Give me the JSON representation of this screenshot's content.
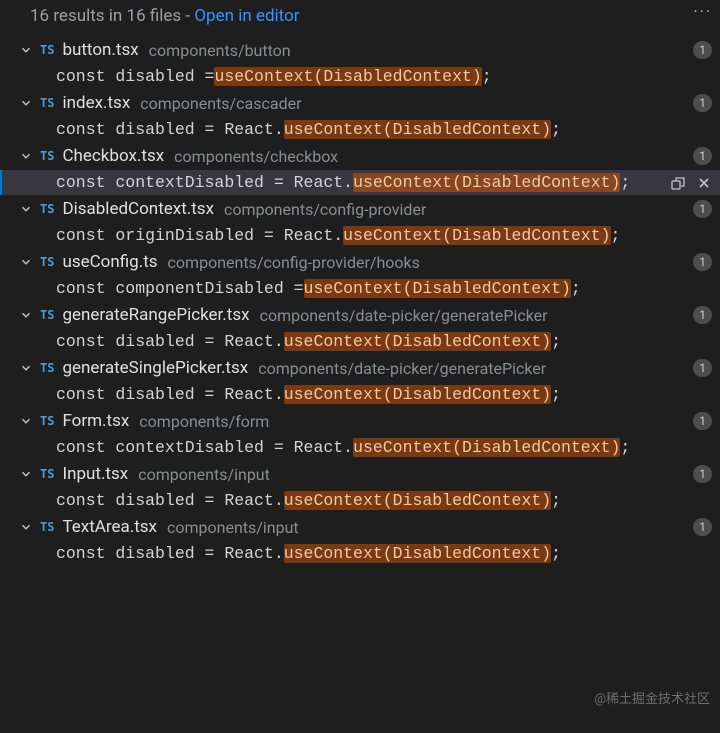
{
  "summary": {
    "text_left": "16 results in 16 files - ",
    "link": "Open in editor"
  },
  "ts_label": "TS",
  "more_label": "···",
  "watermark": "@稀土掘金技术社区",
  "files": [
    {
      "name": "button.tsx",
      "path": "components/button",
      "count": "1",
      "match": {
        "pre": "const disabled = ",
        "hl": "useContext(DisabledContext)",
        "post": ";"
      },
      "selected": false
    },
    {
      "name": "index.tsx",
      "path": "components/cascader",
      "count": "1",
      "match": {
        "pre": "const disabled = React.",
        "hl": "useContext(DisabledContext)",
        "post": ";"
      },
      "selected": false
    },
    {
      "name": "Checkbox.tsx",
      "path": "components/checkbox",
      "count": "1",
      "match": {
        "pre": "const contextDisabled = React.",
        "hl": "useContext(DisabledContext)",
        "post": ";"
      },
      "selected": true
    },
    {
      "name": "DisabledContext.tsx",
      "path": "components/config-provider",
      "count": "1",
      "match": {
        "pre": "const originDisabled = React.",
        "hl": "useContext(DisabledContext)",
        "post": ";"
      },
      "selected": false
    },
    {
      "name": "useConfig.ts",
      "path": "components/config-provider/hooks",
      "count": "1",
      "match": {
        "pre": "const componentDisabled = ",
        "hl": "useContext(DisabledContext)",
        "post": ";"
      },
      "selected": false
    },
    {
      "name": "generateRangePicker.tsx",
      "path": "components/date-picker/generatePicker",
      "count": "1",
      "match": {
        "pre": "const disabled = React.",
        "hl": "useContext(DisabledContext)",
        "post": ";"
      },
      "selected": false
    },
    {
      "name": "generateSinglePicker.tsx",
      "path": "components/date-picker/generatePicker",
      "count": "1",
      "match": {
        "pre": "const disabled = React.",
        "hl": "useContext(DisabledContext)",
        "post": ";"
      },
      "selected": false
    },
    {
      "name": "Form.tsx",
      "path": "components/form",
      "count": "1",
      "match": {
        "pre": "const contextDisabled = React.",
        "hl": "useContext(DisabledContext)",
        "post": ";"
      },
      "selected": false
    },
    {
      "name": "Input.tsx",
      "path": "components/input",
      "count": "1",
      "match": {
        "pre": "const disabled = React.",
        "hl": "useContext(DisabledContext)",
        "post": ";"
      },
      "selected": false
    },
    {
      "name": "TextArea.tsx",
      "path": "components/input",
      "count": "1",
      "match": {
        "pre": "const disabled = React.",
        "hl": "useContext(DisabledContext)",
        "post": ";"
      },
      "selected": false
    }
  ]
}
